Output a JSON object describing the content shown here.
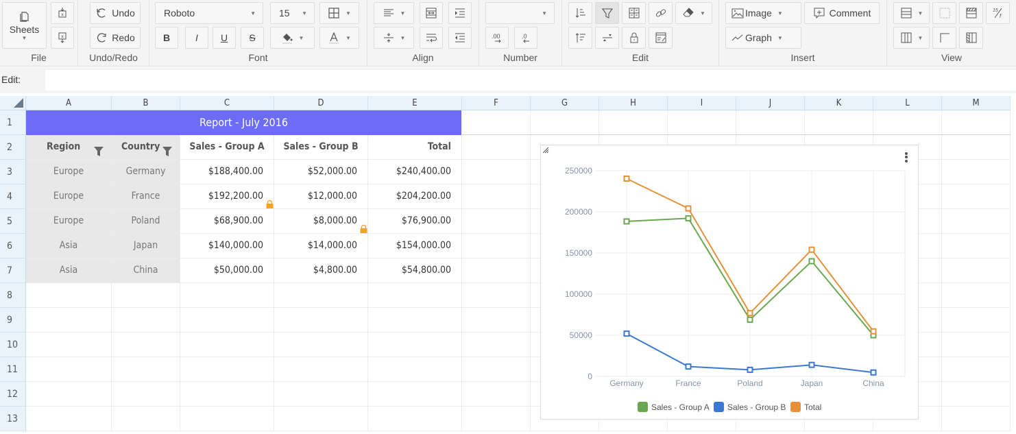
{
  "toolbar": {
    "groups": {
      "file": "File",
      "undo_redo": "Undo/Redo",
      "font": "Font",
      "align": "Align",
      "number": "Number",
      "edit": "Edit",
      "insert": "Insert",
      "view": "View"
    },
    "sheets_label": "Sheets",
    "undo_label": "Undo",
    "redo_label": "Redo",
    "font_family": "Roboto",
    "font_size": "15",
    "number_format": "",
    "bold": "B",
    "italic": "I",
    "underline": "U",
    "strike": "S",
    "image_label": "Image",
    "comment_label": "Comment",
    "graph_label": "Graph",
    "accent_color": "#6c6cf9"
  },
  "editbar": {
    "label": "Edit:",
    "value": ""
  },
  "sheet": {
    "columns": [
      "A",
      "B",
      "C",
      "D",
      "E",
      "F",
      "G",
      "H",
      "I",
      "J",
      "K",
      "L",
      "M"
    ],
    "rows": [
      "1",
      "2",
      "3",
      "4",
      "5",
      "6",
      "7",
      "8",
      "9",
      "10",
      "11",
      "12",
      "13"
    ],
    "title": "Report - July 2016",
    "headers": [
      "Region",
      "Country",
      "Sales - Group A",
      "Sales - Group B",
      "Total"
    ],
    "data": [
      [
        "Europe",
        "Germany",
        "$188,400.00",
        "$52,000.00",
        "$240,400.00"
      ],
      [
        "Europe",
        "France",
        "$192,200.00",
        "$12,000.00",
        "$204,200.00"
      ],
      [
        "Europe",
        "Poland",
        "$68,900.00",
        "$8,000.00",
        "$76,900.00"
      ],
      [
        "Asia",
        "Japan",
        "$140,000.00",
        "$14,000.00",
        "$154,000.00"
      ],
      [
        "Asia",
        "China",
        "$50,000.00",
        "$4,800.00",
        "$54,800.00"
      ]
    ],
    "locked_cells": [
      "C4",
      "D5"
    ]
  },
  "chart_data": {
    "type": "line",
    "title": "",
    "xlabel": "",
    "ylabel": "",
    "categories": [
      "Germany",
      "France",
      "Poland",
      "Japan",
      "China"
    ],
    "series": [
      {
        "name": "Sales - Group A",
        "color": "#6aa84f",
        "values": [
          188400,
          192200,
          68900,
          140000,
          50000
        ]
      },
      {
        "name": "Sales - Group B",
        "color": "#3a78d4",
        "values": [
          52000,
          12000,
          8000,
          14000,
          4800
        ]
      },
      {
        "name": "Total",
        "color": "#e69138",
        "values": [
          240400,
          204200,
          76900,
          154000,
          54800
        ]
      }
    ],
    "yticks": [
      0,
      50000,
      100000,
      150000,
      200000,
      250000
    ],
    "ylim": [
      0,
      250000
    ],
    "grid": true,
    "legend": "bottom",
    "marker": "square"
  }
}
